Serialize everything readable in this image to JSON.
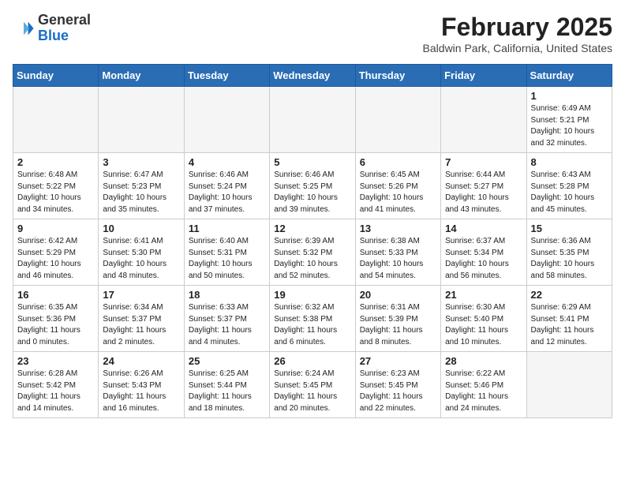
{
  "header": {
    "logo_line1": "General",
    "logo_line2": "Blue",
    "month_title": "February 2025",
    "location": "Baldwin Park, California, United States"
  },
  "days_of_week": [
    "Sunday",
    "Monday",
    "Tuesday",
    "Wednesday",
    "Thursday",
    "Friday",
    "Saturday"
  ],
  "weeks": [
    [
      {
        "day": "",
        "info": ""
      },
      {
        "day": "",
        "info": ""
      },
      {
        "day": "",
        "info": ""
      },
      {
        "day": "",
        "info": ""
      },
      {
        "day": "",
        "info": ""
      },
      {
        "day": "",
        "info": ""
      },
      {
        "day": "1",
        "info": "Sunrise: 6:49 AM\nSunset: 5:21 PM\nDaylight: 10 hours and 32 minutes."
      }
    ],
    [
      {
        "day": "2",
        "info": "Sunrise: 6:48 AM\nSunset: 5:22 PM\nDaylight: 10 hours and 34 minutes."
      },
      {
        "day": "3",
        "info": "Sunrise: 6:47 AM\nSunset: 5:23 PM\nDaylight: 10 hours and 35 minutes."
      },
      {
        "day": "4",
        "info": "Sunrise: 6:46 AM\nSunset: 5:24 PM\nDaylight: 10 hours and 37 minutes."
      },
      {
        "day": "5",
        "info": "Sunrise: 6:46 AM\nSunset: 5:25 PM\nDaylight: 10 hours and 39 minutes."
      },
      {
        "day": "6",
        "info": "Sunrise: 6:45 AM\nSunset: 5:26 PM\nDaylight: 10 hours and 41 minutes."
      },
      {
        "day": "7",
        "info": "Sunrise: 6:44 AM\nSunset: 5:27 PM\nDaylight: 10 hours and 43 minutes."
      },
      {
        "day": "8",
        "info": "Sunrise: 6:43 AM\nSunset: 5:28 PM\nDaylight: 10 hours and 45 minutes."
      }
    ],
    [
      {
        "day": "9",
        "info": "Sunrise: 6:42 AM\nSunset: 5:29 PM\nDaylight: 10 hours and 46 minutes."
      },
      {
        "day": "10",
        "info": "Sunrise: 6:41 AM\nSunset: 5:30 PM\nDaylight: 10 hours and 48 minutes."
      },
      {
        "day": "11",
        "info": "Sunrise: 6:40 AM\nSunset: 5:31 PM\nDaylight: 10 hours and 50 minutes."
      },
      {
        "day": "12",
        "info": "Sunrise: 6:39 AM\nSunset: 5:32 PM\nDaylight: 10 hours and 52 minutes."
      },
      {
        "day": "13",
        "info": "Sunrise: 6:38 AM\nSunset: 5:33 PM\nDaylight: 10 hours and 54 minutes."
      },
      {
        "day": "14",
        "info": "Sunrise: 6:37 AM\nSunset: 5:34 PM\nDaylight: 10 hours and 56 minutes."
      },
      {
        "day": "15",
        "info": "Sunrise: 6:36 AM\nSunset: 5:35 PM\nDaylight: 10 hours and 58 minutes."
      }
    ],
    [
      {
        "day": "16",
        "info": "Sunrise: 6:35 AM\nSunset: 5:36 PM\nDaylight: 11 hours and 0 minutes."
      },
      {
        "day": "17",
        "info": "Sunrise: 6:34 AM\nSunset: 5:37 PM\nDaylight: 11 hours and 2 minutes."
      },
      {
        "day": "18",
        "info": "Sunrise: 6:33 AM\nSunset: 5:37 PM\nDaylight: 11 hours and 4 minutes."
      },
      {
        "day": "19",
        "info": "Sunrise: 6:32 AM\nSunset: 5:38 PM\nDaylight: 11 hours and 6 minutes."
      },
      {
        "day": "20",
        "info": "Sunrise: 6:31 AM\nSunset: 5:39 PM\nDaylight: 11 hours and 8 minutes."
      },
      {
        "day": "21",
        "info": "Sunrise: 6:30 AM\nSunset: 5:40 PM\nDaylight: 11 hours and 10 minutes."
      },
      {
        "day": "22",
        "info": "Sunrise: 6:29 AM\nSunset: 5:41 PM\nDaylight: 11 hours and 12 minutes."
      }
    ],
    [
      {
        "day": "23",
        "info": "Sunrise: 6:28 AM\nSunset: 5:42 PM\nDaylight: 11 hours and 14 minutes."
      },
      {
        "day": "24",
        "info": "Sunrise: 6:26 AM\nSunset: 5:43 PM\nDaylight: 11 hours and 16 minutes."
      },
      {
        "day": "25",
        "info": "Sunrise: 6:25 AM\nSunset: 5:44 PM\nDaylight: 11 hours and 18 minutes."
      },
      {
        "day": "26",
        "info": "Sunrise: 6:24 AM\nSunset: 5:45 PM\nDaylight: 11 hours and 20 minutes."
      },
      {
        "day": "27",
        "info": "Sunrise: 6:23 AM\nSunset: 5:45 PM\nDaylight: 11 hours and 22 minutes."
      },
      {
        "day": "28",
        "info": "Sunrise: 6:22 AM\nSunset: 5:46 PM\nDaylight: 11 hours and 24 minutes."
      },
      {
        "day": "",
        "info": ""
      }
    ]
  ]
}
